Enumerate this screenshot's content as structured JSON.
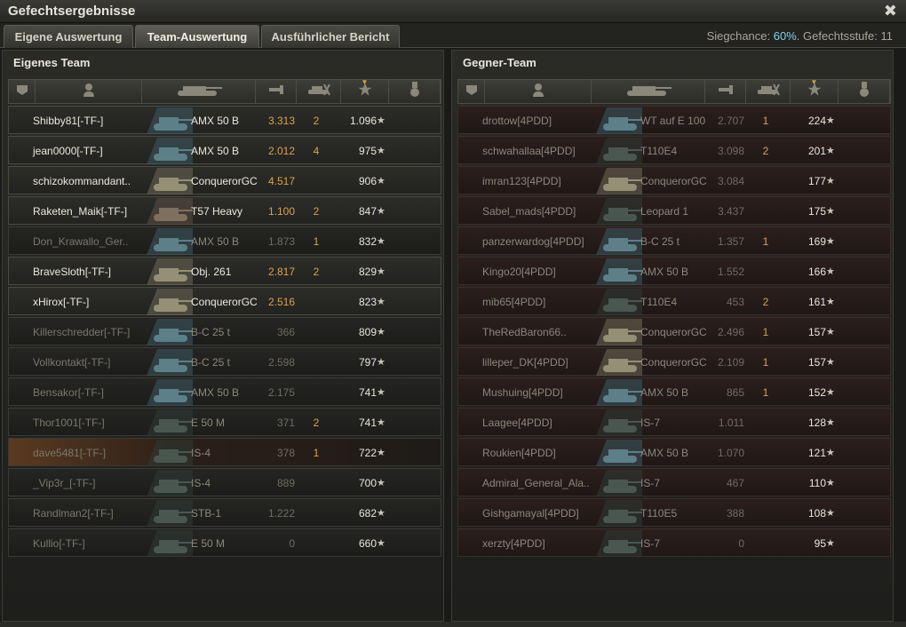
{
  "window": {
    "title": "Gefechtsergebnisse",
    "close_glyph": "✖"
  },
  "tabs": [
    {
      "label": "Eigene Auswertung"
    },
    {
      "label": "Team-Auswertung"
    },
    {
      "label": "Ausführlicher Bericht"
    }
  ],
  "status": {
    "win_chance_label": "Siegchance:",
    "win_chance_value": "60%",
    "battle_tier_label": "Gefechtsstufe:",
    "battle_tier_value": "11"
  },
  "colors": {
    "accent_orange": "#d9a34a",
    "accent_blue": "#7fd1e8",
    "player_highlight": "#5a3a20"
  },
  "icons": [
    "platoon-icon",
    "player-icon",
    "tank-icon",
    "damage-icon",
    "kills-icon",
    "xp-star-icon",
    "medal-icon",
    "close-icon"
  ],
  "own_team": {
    "title": "Eigenes Team",
    "rows": [
      {
        "name": "Shibby81[-TF-]",
        "tank": "AMX 50 B",
        "damage": "3.313",
        "kills": "2",
        "xp": "1.096",
        "alive": true,
        "tank_class": "blue"
      },
      {
        "name": "jean0000[-TF-]",
        "tank": "AMX 50 B",
        "damage": "2.012",
        "kills": "4",
        "xp": "975",
        "alive": true,
        "tank_class": "blue"
      },
      {
        "name": "schizokommandant..",
        "tank": "ConquerorGC",
        "damage": "4.517",
        "kills": "",
        "xp": "906",
        "alive": true,
        "tank_class": "spg"
      },
      {
        "name": "Raketen_Maik[-TF-]",
        "tank": "T57 Heavy",
        "damage": "1.100",
        "kills": "2",
        "xp": "847",
        "alive": true,
        "tank_class": "heavy"
      },
      {
        "name": "Don_Krawallo_Ger..",
        "tank": "AMX 50 B",
        "damage": "1.873",
        "kills": "1",
        "xp": "832",
        "alive": false,
        "tank_class": "blue"
      },
      {
        "name": "BraveSloth[-TF-]",
        "tank": "Obj. 261",
        "damage": "2.817",
        "kills": "2",
        "xp": "829",
        "alive": true,
        "tank_class": "spg"
      },
      {
        "name": "xHirox[-TF-]",
        "tank": "ConquerorGC",
        "damage": "2.516",
        "kills": "",
        "xp": "823",
        "alive": true,
        "tank_class": "spg"
      },
      {
        "name": "Killerschredder[-TF-]",
        "tank": "B-C 25 t",
        "damage": "366",
        "kills": "",
        "xp": "809",
        "alive": false,
        "tank_class": "blue"
      },
      {
        "name": "Vollkontakt[-TF-]",
        "tank": "B-C 25 t",
        "damage": "2.598",
        "kills": "",
        "xp": "797",
        "alive": false,
        "tank_class": "blue"
      },
      {
        "name": "Bensakor[-TF-]",
        "tank": "AMX 50 B",
        "damage": "2.175",
        "kills": "",
        "xp": "741",
        "alive": false,
        "tank_class": "blue"
      },
      {
        "name": "Thor1001[-TF-]",
        "tank": "E 50 M",
        "damage": "371",
        "kills": "2",
        "xp": "741",
        "alive": false,
        "tank_class": "dark"
      },
      {
        "name": "dave5481[-TF-]",
        "tank": "IS-4",
        "damage": "378",
        "kills": "1",
        "xp": "722",
        "alive": false,
        "player": true,
        "tank_class": "dark"
      },
      {
        "name": "_Vip3r_[-TF-]",
        "tank": "IS-4",
        "damage": "889",
        "kills": "",
        "xp": "700",
        "alive": false,
        "tank_class": "dark"
      },
      {
        "name": "Randlman2[-TF-]",
        "tank": "STB-1",
        "damage": "1.222",
        "kills": "",
        "xp": "682",
        "alive": false,
        "tank_class": "dark"
      },
      {
        "name": "Kullio[-TF-]",
        "tank": "E 50 M",
        "damage": "0",
        "kills": "",
        "xp": "660",
        "alive": false,
        "tank_class": "dark"
      }
    ]
  },
  "enemy_team": {
    "title": "Gegner-Team",
    "rows": [
      {
        "name": "drottow[4PDD]",
        "tank": "WT auf E 100",
        "damage": "2.707",
        "kills": "1",
        "xp": "224",
        "tank_class": "blue"
      },
      {
        "name": "schwahallaa[4PDD]",
        "tank": "T110E4",
        "damage": "3.098",
        "kills": "2",
        "xp": "201",
        "tank_class": "dark"
      },
      {
        "name": "imran123[4PDD]",
        "tank": "ConquerorGC",
        "damage": "3.084",
        "kills": "",
        "xp": "177",
        "tank_class": "spg"
      },
      {
        "name": "Sabel_mads[4PDD]",
        "tank": "Leopard 1",
        "damage": "3.437",
        "kills": "",
        "xp": "175",
        "tank_class": "dark"
      },
      {
        "name": "panzerwardog[4PDD]",
        "tank": "B-C 25 t",
        "damage": "1.357",
        "kills": "1",
        "xp": "169",
        "tank_class": "blue"
      },
      {
        "name": "Kingo20[4PDD]",
        "tank": "AMX 50 B",
        "damage": "1.552",
        "kills": "",
        "xp": "166",
        "tank_class": "blue"
      },
      {
        "name": "mib65[4PDD]",
        "tank": "T110E4",
        "damage": "453",
        "kills": "2",
        "xp": "161",
        "tank_class": "dark"
      },
      {
        "name": "TheRedBaron66..",
        "tank": "ConquerorGC",
        "damage": "2.496",
        "kills": "1",
        "xp": "157",
        "tank_class": "spg"
      },
      {
        "name": "lilleper_DK[4PDD]",
        "tank": "ConquerorGC",
        "damage": "2.109",
        "kills": "1",
        "xp": "157",
        "tank_class": "spg"
      },
      {
        "name": "Mushuing[4PDD]",
        "tank": "AMX 50 B",
        "damage": "865",
        "kills": "1",
        "xp": "152",
        "tank_class": "blue"
      },
      {
        "name": "Laagee[4PDD]",
        "tank": "IS-7",
        "damage": "1.011",
        "kills": "",
        "xp": "128",
        "tank_class": "dark"
      },
      {
        "name": "Roukien[4PDD]",
        "tank": "AMX 50 B",
        "damage": "1.070",
        "kills": "",
        "xp": "121",
        "tank_class": "blue"
      },
      {
        "name": "Admiral_General_Ala..",
        "tank": "IS-7",
        "damage": "467",
        "kills": "",
        "xp": "110",
        "tank_class": "dark"
      },
      {
        "name": "Gishgamayal[4PDD]",
        "tank": "T110E5",
        "damage": "388",
        "kills": "",
        "xp": "108",
        "tank_class": "dark"
      },
      {
        "name": "xerzty[4PDD]",
        "tank": "IS-7",
        "damage": "0",
        "kills": "",
        "xp": "95",
        "tank_class": "dark"
      }
    ]
  },
  "star_glyph": "★"
}
